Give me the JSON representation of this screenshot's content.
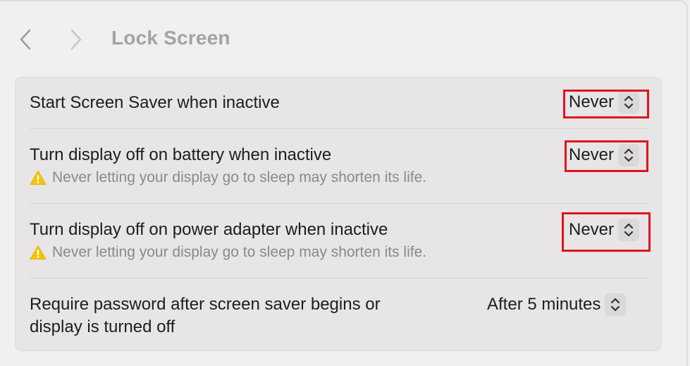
{
  "header": {
    "title": "Lock Screen",
    "back_icon": "chevron-left-icon",
    "forward_icon": "chevron-right-icon"
  },
  "settings": [
    {
      "label": "Start Screen Saver when inactive",
      "value": "Never"
    },
    {
      "label": "Turn display off on battery when inactive",
      "warning": "Never letting your display go to sleep may shorten its life.",
      "value": "Never"
    },
    {
      "label": "Turn display off on power adapter when inactive",
      "warning": "Never letting your display go to sleep may shorten its life.",
      "value": "Never"
    },
    {
      "label_line1": "Require password after screen saver begins or",
      "label_line2": "display is turned off",
      "value": "After 5 minutes"
    }
  ],
  "colors": {
    "highlight": "#e0141e",
    "warning_yellow": "#f5c400"
  }
}
